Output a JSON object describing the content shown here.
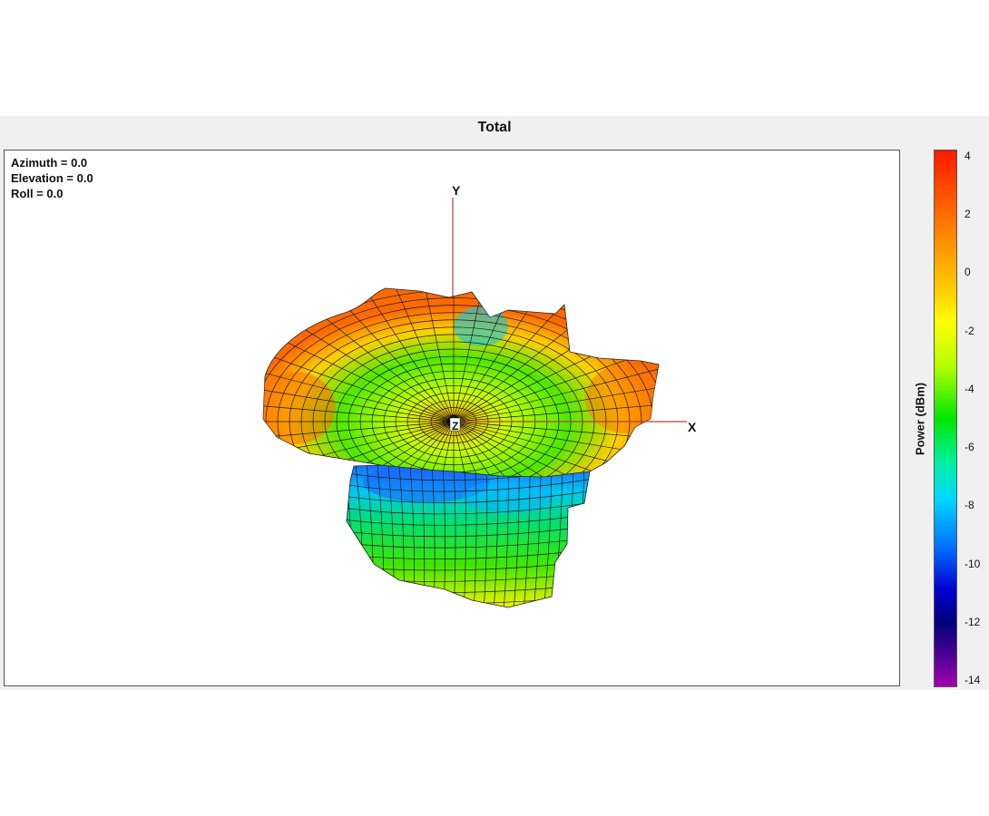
{
  "chart_data": {
    "type": "3d-radiation-pattern-surface",
    "title": "Total",
    "view": {
      "azimuth": "Azimuth = 0.0",
      "elevation": "Elevation = 0.0",
      "roll": "Roll = 0.0"
    },
    "axes": {
      "x": "X",
      "y": "Y",
      "z": "Z"
    },
    "colorbar": {
      "label": "Power (dBm)",
      "ticks": [
        "4",
        "2",
        "0",
        "-2",
        "-4",
        "-6",
        "-8",
        "-10",
        "-12",
        "-14"
      ],
      "range": [
        -15,
        4.5
      ]
    },
    "colors": {
      "max": "#ff2a00",
      "high": "#ff8c00",
      "mid": "#00e600",
      "low": "#00c0ff",
      "min": "#9a00b0"
    }
  }
}
